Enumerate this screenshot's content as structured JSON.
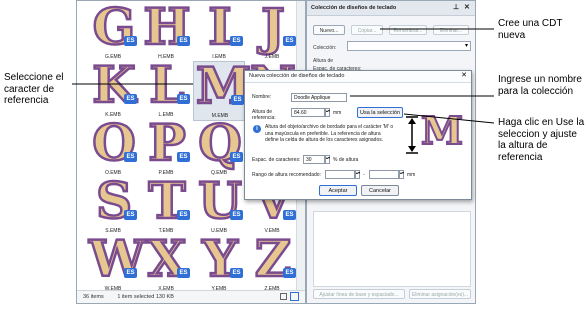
{
  "browser": {
    "tiles": [
      {
        "letter": "G",
        "file": "G.EMB"
      },
      {
        "letter": "H",
        "file": "H.EMB"
      },
      {
        "letter": "I",
        "file": "I.EMB"
      },
      {
        "letter": "J",
        "file": "J.EMB"
      },
      {
        "letter": "K",
        "file": "K.EMB"
      },
      {
        "letter": "L",
        "file": "L.EMB"
      },
      {
        "letter": "M",
        "file": "M.EMB"
      },
      {
        "letter": "N",
        "file": "N.EMB"
      },
      {
        "letter": "O",
        "file": "O.EMB"
      },
      {
        "letter": "P",
        "file": "P.EMB"
      },
      {
        "letter": "Q",
        "file": "Q.EMB"
      },
      {
        "letter": "R",
        "file": "R.EMB"
      },
      {
        "letter": "S",
        "file": "S.EMB"
      },
      {
        "letter": "T",
        "file": "T.EMB"
      },
      {
        "letter": "U",
        "file": "U.EMB"
      },
      {
        "letter": "V",
        "file": "V.EMB"
      },
      {
        "letter": "W",
        "file": "W.EMB"
      },
      {
        "letter": "X",
        "file": "X.EMB"
      },
      {
        "letter": "Y",
        "file": "Y.EMB"
      },
      {
        "letter": "Z",
        "file": "Z.EMB"
      }
    ],
    "badge": "ES",
    "selected_file": "M.EMB",
    "status": {
      "items": "36 items",
      "selected": "1 item selected  130 KB"
    }
  },
  "docker": {
    "title": "Colección de diseños de teclado",
    "pin_icon": "pin-icon",
    "close_icon": "close-icon",
    "new_button": "Nuevo...",
    "copy_button": "Copiar...",
    "rename_button": "Renombrar...",
    "delete_button": "Eliminar...",
    "collection_label": "Colección:",
    "height_label": "Altura de",
    "spacing_label": "Espac. de caracteres:",
    "adjust_button": "Ajustar línea de base y espaciado...",
    "remove_button": "Eliminar asignación(es)..."
  },
  "dialog": {
    "title": "Nueva colección de diseños de teclado",
    "name_label": "Nombre:",
    "name_value": "Doodle Applique",
    "ref_height_label_1": "Altura de",
    "ref_height_label_2": "referencia:",
    "ref_height_value": "84.60",
    "unit_mm": "mm",
    "use_selection_button": "Usa la selección",
    "info_text": "Altura del objeto/archivo de bordado para el carácter 'M' o una mayúscula en preferible. La referencia de altura define la celda de altura de los caracteres asignados.",
    "preview_letter": "M",
    "spacing_label": "Espac. de caracteres:",
    "spacing_value": "30",
    "spacing_unit": "% de altura",
    "range_label": "Rango de altura recomendado:",
    "range_dash": "-",
    "range_unit": "mm",
    "ok_button": "Aceptar",
    "cancel_button": "Cancelar"
  },
  "annotations": {
    "select_char": "Seleccione el caracter de referencia",
    "create_cdt": "Cree una CDT nueva",
    "enter_name": "Ingrese un nombre para la colección",
    "click_use": "Haga clic en Use la seleccion y ajuste la altura de referencia"
  }
}
